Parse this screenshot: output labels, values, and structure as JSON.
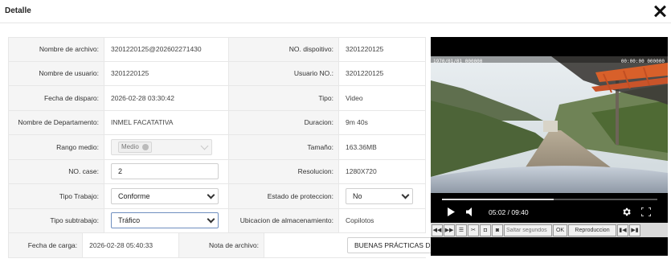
{
  "dialog": {
    "title": "Detalle"
  },
  "fields": {
    "nombre_archivo": {
      "label": "Nombre de archivo:",
      "value": "3201220125@202602271430"
    },
    "no_dispositivo": {
      "label": "NO. dispoitivo:",
      "value": "3201220125"
    },
    "nombre_usuario": {
      "label": "Nombre de usuario:",
      "value": "3201220125"
    },
    "usuario_no": {
      "label": "Usuario NO.:",
      "value": "3201220125"
    },
    "fecha_disparo": {
      "label": "Fecha de disparo:",
      "value": "2026-02-28 03:30:42"
    },
    "tipo": {
      "label": "Tipo:",
      "value": "Video"
    },
    "departamento": {
      "label": "Nombre de Departamento:",
      "value": "INMEL FACATATIVA"
    },
    "duracion": {
      "label": "Duracion:",
      "value": "9m 40s"
    },
    "rango_medio": {
      "label": "Rango medio:",
      "tag": "Medio"
    },
    "tamano": {
      "label": "Tamaño:",
      "value": "163.36MB"
    },
    "no_case": {
      "label": "NO. case:",
      "value": "2"
    },
    "resolucion": {
      "label": "Resolucion:",
      "value": "1280X720"
    },
    "tipo_trabajo": {
      "label": "Tipo Trabajo:",
      "value": "Conforme"
    },
    "estado_proteccion": {
      "label": "Estado de proteccion:",
      "value": "No"
    },
    "tipo_subtrabajo": {
      "label": "Tipo subtrabajo:",
      "value": "Tráfico"
    },
    "ubicacion": {
      "label": "Ubicacion de almacenamiento:",
      "value": "Copilotos"
    },
    "fecha_carga": {
      "label": "Fecha de carga:",
      "value": "2026-02-28 05:40:33"
    },
    "nota_archivo": {
      "label": "Nota de archivo:",
      "value": "BUENAS PRÁCTICAS DE CONDUCCIÓN - diego ortega"
    }
  },
  "player": {
    "osd_left": "1970/01/01 000000",
    "osd_right": "00:00:00 000000",
    "current_time": "05:02",
    "duration": "09:40",
    "time_display": "05:02 / 09:40",
    "progress_fraction": 0.52
  },
  "toolbar": {
    "seek_placeholder": "Saltar segundos",
    "ok_label": "OK",
    "speed_label": "Reproduccion"
  }
}
